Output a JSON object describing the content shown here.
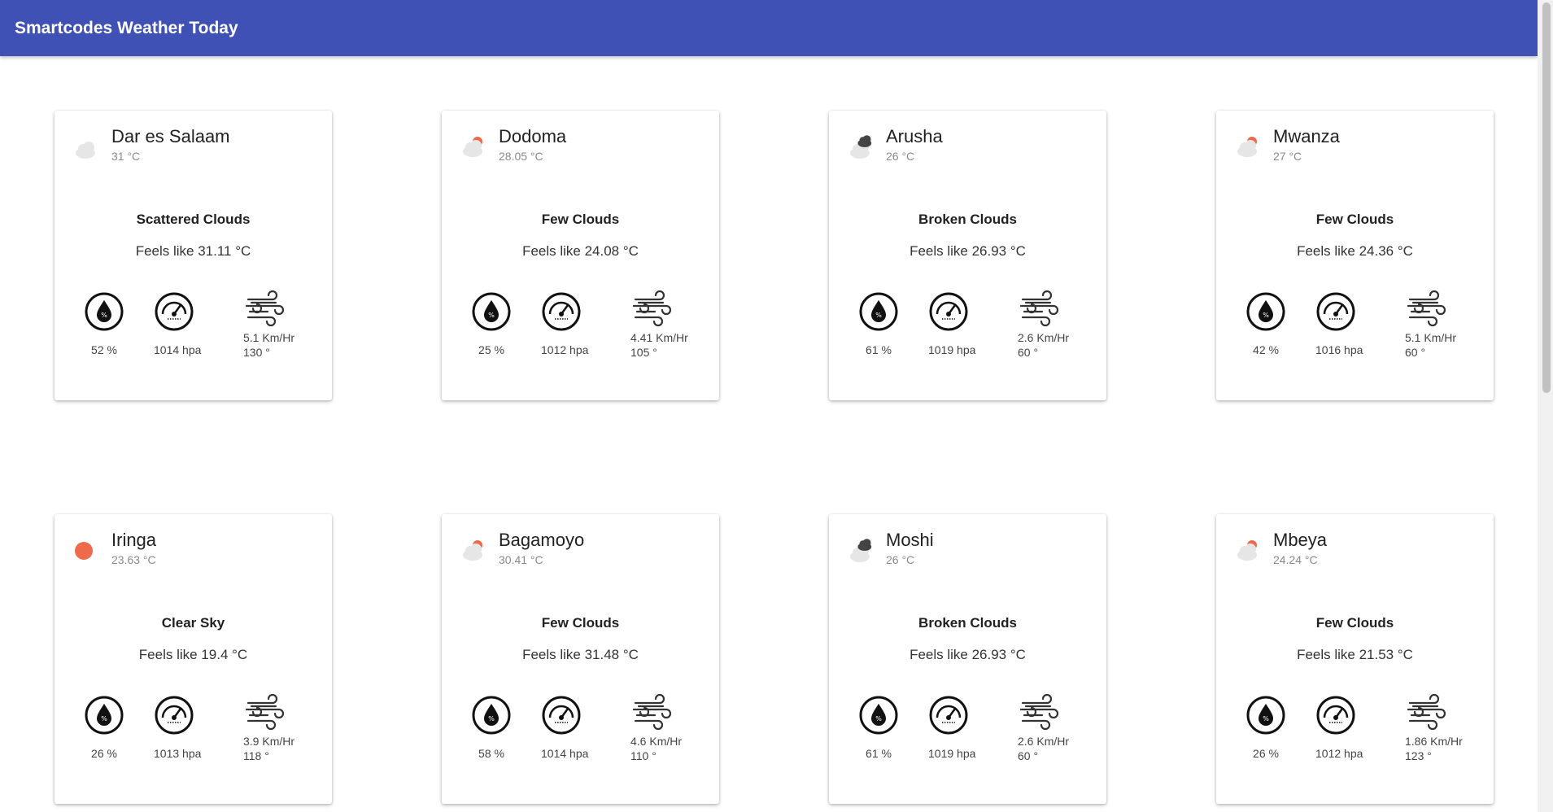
{
  "app": {
    "title": "Smartcodes Weather Today"
  },
  "cities": [
    {
      "name": "Dar es Salaam",
      "temp": "31 °C",
      "description": "Scattered Clouds",
      "feels_like": "Feels like 31.11 °C",
      "humidity": "52 %",
      "pressure": "1014 hpa",
      "wind_speed": "5.1 Km/Hr",
      "wind_deg": "130 °",
      "icon": "scattered-clouds-icon"
    },
    {
      "name": "Dodoma",
      "temp": "28.05 °C",
      "description": "Few Clouds",
      "feels_like": "Feels like 24.08 °C",
      "humidity": "25 %",
      "pressure": "1012 hpa",
      "wind_speed": "4.41 Km/Hr",
      "wind_deg": "105 °",
      "icon": "few-clouds-icon"
    },
    {
      "name": "Arusha",
      "temp": "26 °C",
      "description": "Broken Clouds",
      "feels_like": "Feels like 26.93 °C",
      "humidity": "61 %",
      "pressure": "1019 hpa",
      "wind_speed": "2.6 Km/Hr",
      "wind_deg": "60 °",
      "icon": "broken-clouds-icon"
    },
    {
      "name": "Mwanza",
      "temp": "27 °C",
      "description": "Few Clouds",
      "feels_like": "Feels like 24.36 °C",
      "humidity": "42 %",
      "pressure": "1016 hpa",
      "wind_speed": "5.1 Km/Hr",
      "wind_deg": "60 °",
      "icon": "few-clouds-icon"
    },
    {
      "name": "Iringa",
      "temp": "23.63 °C",
      "description": "Clear Sky",
      "feels_like": "Feels like 19.4 °C",
      "humidity": "26 %",
      "pressure": "1013 hpa",
      "wind_speed": "3.9 Km/Hr",
      "wind_deg": "118 °",
      "icon": "clear-sky-icon"
    },
    {
      "name": "Bagamoyo",
      "temp": "30.41 °C",
      "description": "Few Clouds",
      "feels_like": "Feels like 31.48 °C",
      "humidity": "58 %",
      "pressure": "1014 hpa",
      "wind_speed": "4.6 Km/Hr",
      "wind_deg": "110 °",
      "icon": "few-clouds-icon"
    },
    {
      "name": "Moshi",
      "temp": "26 °C",
      "description": "Broken Clouds",
      "feels_like": "Feels like 26.93 °C",
      "humidity": "61 %",
      "pressure": "1019 hpa",
      "wind_speed": "2.6 Km/Hr",
      "wind_deg": "60 °",
      "icon": "broken-clouds-icon"
    },
    {
      "name": "Mbeya",
      "temp": "24.24 °C",
      "description": "Few Clouds",
      "feels_like": "Feels like 21.53 °C",
      "humidity": "26 %",
      "pressure": "1012 hpa",
      "wind_speed": "1.86 Km/Hr",
      "wind_deg": "123 °",
      "icon": "few-clouds-icon"
    }
  ],
  "colors": {
    "appbar": "#3f51b5",
    "sun": "#ee6a4a",
    "cloud": "#e6e6e6",
    "dark_cloud": "#444444"
  }
}
